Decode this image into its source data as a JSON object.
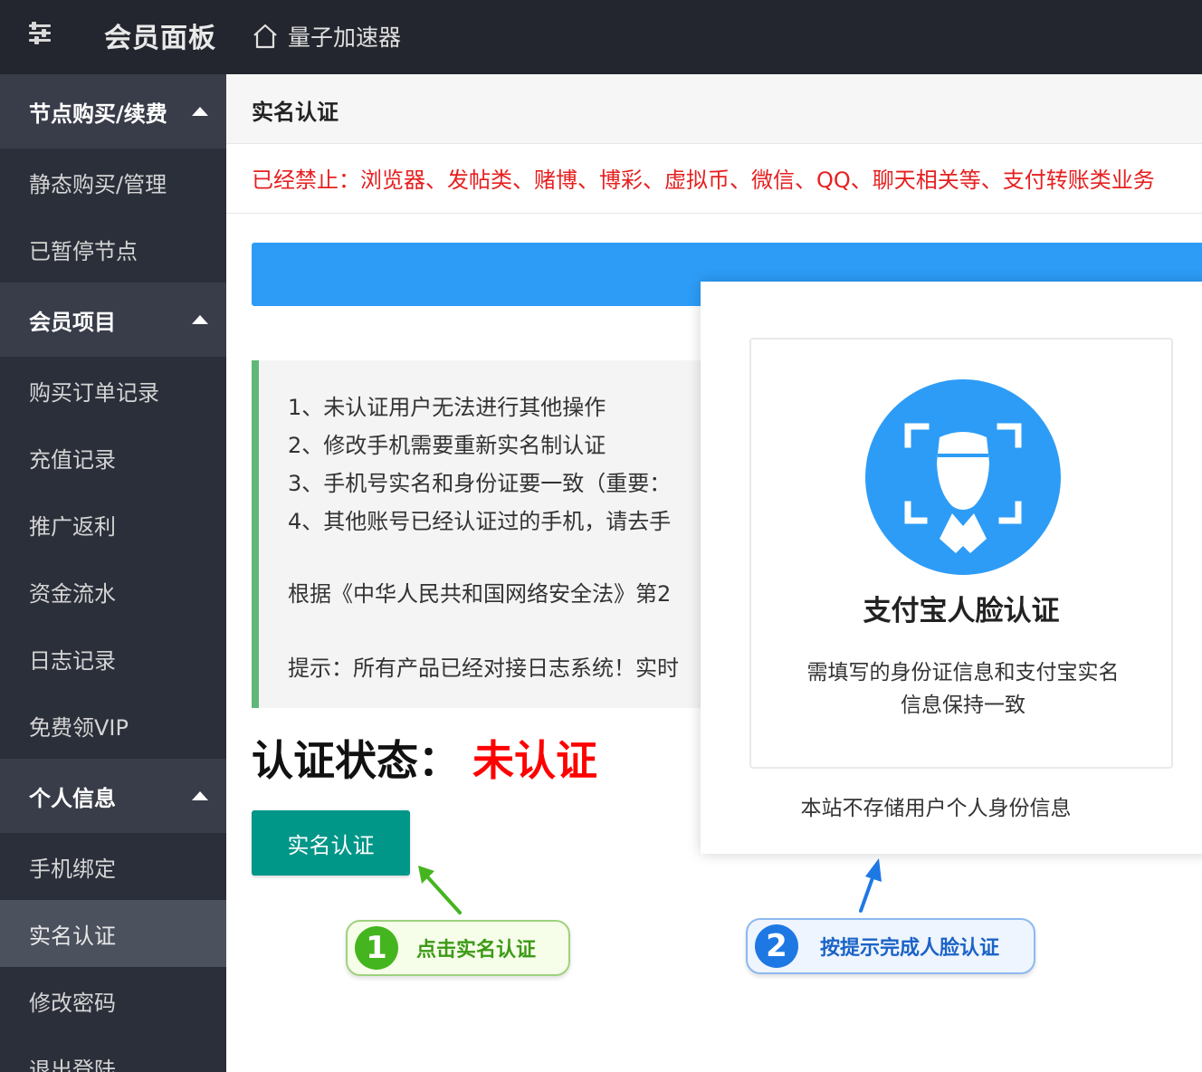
{
  "topbar": {
    "brand": "会员面板",
    "home_label": "量子加速器",
    "menu_icon": "sliders-icon",
    "home_icon": "home-icon"
  },
  "sidebar": {
    "groups": [
      {
        "label": "节点购买/续费",
        "items": [
          "静态购买/管理",
          "已暂停节点"
        ]
      },
      {
        "label": "会员项目",
        "items": [
          "购买订单记录",
          "充值记录",
          "推广返利",
          "资金流水",
          "日志记录",
          "免费领VIP"
        ]
      },
      {
        "label": "个人信息",
        "items": [
          "手机绑定",
          "实名认证",
          "修改密码",
          "退出登陆"
        ]
      }
    ],
    "active_item": "实名认证"
  },
  "main": {
    "card_title": "实名认证",
    "notice": "已经禁止：浏览器、发帖类、赌博、博彩、虚拟币、微信、QQ、聊天相关等、支付转账类业务",
    "info_lines": [
      "1、未认证用户无法进行其他操作",
      "2、修改手机需要重新实名制认证",
      "3、手机号实名和身份证要一致（重要：",
      "4、其他账号已经认证过的手机，请去手"
    ],
    "law_text": "根据《中华人民共和国网络安全法》第2",
    "tip_text": "提示：所有产品已经对接日志系统！实时",
    "status_label": "认证状态：",
    "status_value": "未认证",
    "verify_button": "实名认证"
  },
  "popup": {
    "title": "支付宝人脸认证",
    "desc_line1": "需填写的身份证信息和支付宝实名",
    "desc_line2": "信息保持一致",
    "footer": "本站不存储用户个人身份信息",
    "icon": "face-scan-icon"
  },
  "annotations": {
    "step1_num": "1",
    "step1_text": "点击实名认证",
    "step2_num": "2",
    "step2_text": "按提示完成人脸认证"
  },
  "colors": {
    "topbar": "#23262e",
    "sidebar": "#2b2f3a",
    "notice_red": "#e62020",
    "primary_blue": "#2d9cf6",
    "button_teal": "#009688",
    "status_red": "#ff0000",
    "info_border_green": "#5fb878"
  }
}
